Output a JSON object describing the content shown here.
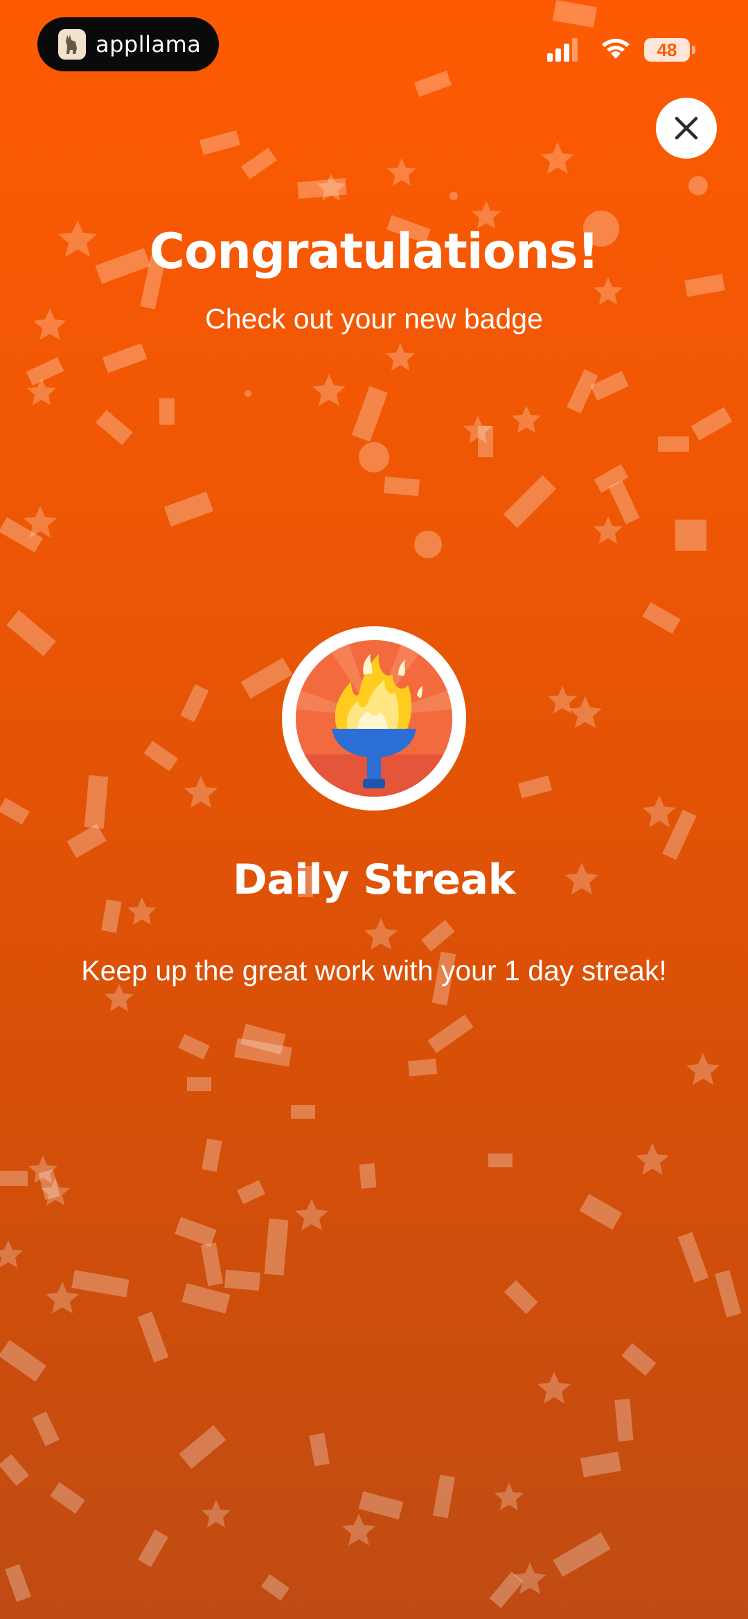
{
  "status_bar": {
    "app_name": "appllama",
    "battery_level": "48",
    "signal_icon": "cellular-signal-icon",
    "wifi_icon": "wifi-icon"
  },
  "header": {
    "title": "Congratulations!",
    "subtitle": "Check out your new badge"
  },
  "badge": {
    "icon": "flame-torch-icon",
    "name": "Daily Streak",
    "description": "Keep up the great work with your 1 day streak!"
  },
  "controls": {
    "close_icon": "close-icon"
  },
  "colors": {
    "background_top": "#fd5a03",
    "background_bottom": "#c04b12",
    "text": "#ffffff",
    "badge_ring": "#ffffff",
    "badge_inner": "#f26a3d",
    "torch_cup": "#2b6fd6",
    "flame": "#ffcc1f"
  }
}
